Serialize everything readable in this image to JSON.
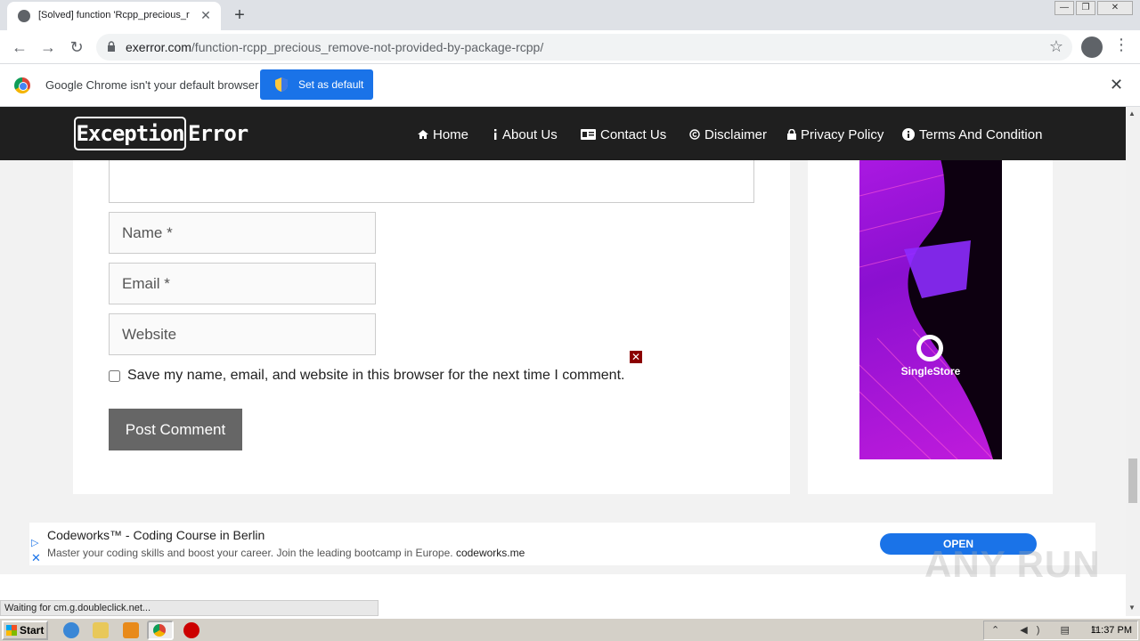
{
  "browser": {
    "tab_title": "[Solved] function 'Rcpp_precious_re",
    "tab_close": "✕",
    "new_tab": "+",
    "url_domain": "exerror.com",
    "url_path": "/function-rcpp_precious_remove-not-provided-by-package-rcpp/",
    "back": "←",
    "forward": "→",
    "reload": "↻",
    "bookmark_star": "☆",
    "menu": "⋮",
    "window_minimize": "—",
    "window_restore": "❐",
    "window_close": "✕"
  },
  "infobar": {
    "message": "Google Chrome isn't your default browser",
    "button": "Set as default",
    "close": "✕"
  },
  "site": {
    "logo_boxed": "Exception",
    "logo_rest": "Error",
    "nav": [
      {
        "label": "Home",
        "icon": "home-icon"
      },
      {
        "label": "About Us",
        "icon": "info-icon"
      },
      {
        "label": "Contact Us",
        "icon": "contact-card-icon"
      },
      {
        "label": "Disclaimer",
        "icon": "copyright-icon"
      },
      {
        "label": "Privacy Policy",
        "icon": "lock-icon"
      },
      {
        "label": "Terms And Condition",
        "icon": "info-circle-icon"
      }
    ]
  },
  "comment_form": {
    "name_placeholder": "Name *",
    "email_placeholder": "Email *",
    "website_placeholder": "Website",
    "save_label": "Save my name, email, and website in this browser for the next time I comment.",
    "submit": "Post Comment",
    "ad_close": "✕"
  },
  "sidebar_ad": {
    "brand": "SingleStore"
  },
  "bottom_ad": {
    "headline": "Codeworks™ - Coding Course in Berlin",
    "description": "Master your coding skills and boost your career. Join the leading bootcamp in Europe.",
    "domain": "codeworks.me",
    "cta": "OPEN",
    "play": "▷",
    "close": "✕"
  },
  "status": {
    "text": "Waiting for cm.g.doubleclick.net..."
  },
  "watermark": "ANY RUN",
  "taskbar": {
    "start": "Start",
    "clock": "11:37 PM",
    "tray_icons": "⌃ ◀) ▤ ⚐"
  },
  "colors": {
    "header_bg": "#1f1f1f",
    "accent_blue": "#1a73e8",
    "ad_purple": "#9b16d8",
    "button_grey": "#666666"
  }
}
